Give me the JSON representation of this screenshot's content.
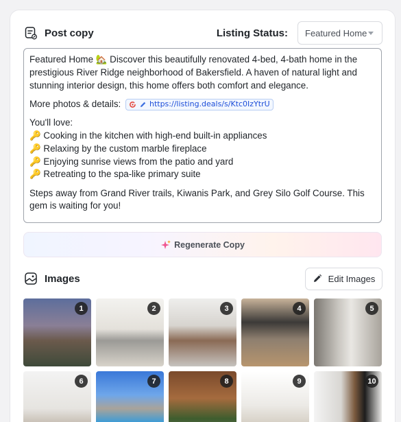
{
  "post": {
    "title": "Post copy",
    "icon": "post-copy-icon"
  },
  "listing_status": {
    "label": "Listing Status:",
    "selected": "Featured Home"
  },
  "copy": {
    "intro": "Featured Home 🏡 Discover this beautifully renovated 4-bed, 4-bath home in the prestigious River Ridge neighborhood of Bakersfield. A haven of natural light and stunning interior design, this home offers both comfort and elegance.",
    "more_label": "More photos & details:",
    "link": "https://listing.deals/s/Ktc0IzYtrU",
    "love_heading": "You'll love:",
    "features": [
      "🔑 Cooking in the kitchen with high-end built-in appliances",
      "🔑 Relaxing by the custom marble fireplace",
      "🔑 Enjoying sunrise views from the patio and yard",
      "🔑 Retreating to the spa-like primary suite"
    ],
    "closing": "Steps away from Grand River trails, Kiwanis Park, and Grey Silo Golf Course. This gem is waiting for you!"
  },
  "regenerate": {
    "label": "Regenerate Copy"
  },
  "images": {
    "title": "Images",
    "edit_label": "Edit Images",
    "items": [
      {
        "num": "1"
      },
      {
        "num": "2"
      },
      {
        "num": "3"
      },
      {
        "num": "4"
      },
      {
        "num": "5"
      },
      {
        "num": "6"
      },
      {
        "num": "7"
      },
      {
        "num": "8"
      },
      {
        "num": "9"
      },
      {
        "num": "10"
      }
    ]
  },
  "colors": {
    "link": "#1d4ed8",
    "regen_gradient": [
      "#f0f5ff",
      "#ffe6ef"
    ]
  }
}
